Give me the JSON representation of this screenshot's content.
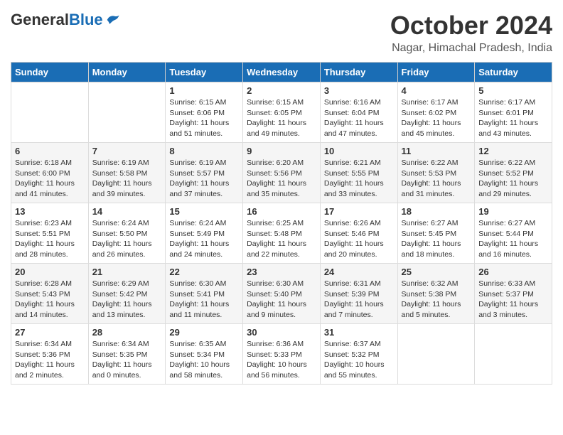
{
  "header": {
    "logo_general": "General",
    "logo_blue": "Blue",
    "month_title": "October 2024",
    "location": "Nagar, Himachal Pradesh, India"
  },
  "weekdays": [
    "Sunday",
    "Monday",
    "Tuesday",
    "Wednesday",
    "Thursday",
    "Friday",
    "Saturday"
  ],
  "weeks": [
    [
      {
        "day": "",
        "sunrise": "",
        "sunset": "",
        "daylight": ""
      },
      {
        "day": "",
        "sunrise": "",
        "sunset": "",
        "daylight": ""
      },
      {
        "day": "1",
        "sunrise": "Sunrise: 6:15 AM",
        "sunset": "Sunset: 6:06 PM",
        "daylight": "Daylight: 11 hours and 51 minutes."
      },
      {
        "day": "2",
        "sunrise": "Sunrise: 6:15 AM",
        "sunset": "Sunset: 6:05 PM",
        "daylight": "Daylight: 11 hours and 49 minutes."
      },
      {
        "day": "3",
        "sunrise": "Sunrise: 6:16 AM",
        "sunset": "Sunset: 6:04 PM",
        "daylight": "Daylight: 11 hours and 47 minutes."
      },
      {
        "day": "4",
        "sunrise": "Sunrise: 6:17 AM",
        "sunset": "Sunset: 6:02 PM",
        "daylight": "Daylight: 11 hours and 45 minutes."
      },
      {
        "day": "5",
        "sunrise": "Sunrise: 6:17 AM",
        "sunset": "Sunset: 6:01 PM",
        "daylight": "Daylight: 11 hours and 43 minutes."
      }
    ],
    [
      {
        "day": "6",
        "sunrise": "Sunrise: 6:18 AM",
        "sunset": "Sunset: 6:00 PM",
        "daylight": "Daylight: 11 hours and 41 minutes."
      },
      {
        "day": "7",
        "sunrise": "Sunrise: 6:19 AM",
        "sunset": "Sunset: 5:58 PM",
        "daylight": "Daylight: 11 hours and 39 minutes."
      },
      {
        "day": "8",
        "sunrise": "Sunrise: 6:19 AM",
        "sunset": "Sunset: 5:57 PM",
        "daylight": "Daylight: 11 hours and 37 minutes."
      },
      {
        "day": "9",
        "sunrise": "Sunrise: 6:20 AM",
        "sunset": "Sunset: 5:56 PM",
        "daylight": "Daylight: 11 hours and 35 minutes."
      },
      {
        "day": "10",
        "sunrise": "Sunrise: 6:21 AM",
        "sunset": "Sunset: 5:55 PM",
        "daylight": "Daylight: 11 hours and 33 minutes."
      },
      {
        "day": "11",
        "sunrise": "Sunrise: 6:22 AM",
        "sunset": "Sunset: 5:53 PM",
        "daylight": "Daylight: 11 hours and 31 minutes."
      },
      {
        "day": "12",
        "sunrise": "Sunrise: 6:22 AM",
        "sunset": "Sunset: 5:52 PM",
        "daylight": "Daylight: 11 hours and 29 minutes."
      }
    ],
    [
      {
        "day": "13",
        "sunrise": "Sunrise: 6:23 AM",
        "sunset": "Sunset: 5:51 PM",
        "daylight": "Daylight: 11 hours and 28 minutes."
      },
      {
        "day": "14",
        "sunrise": "Sunrise: 6:24 AM",
        "sunset": "Sunset: 5:50 PM",
        "daylight": "Daylight: 11 hours and 26 minutes."
      },
      {
        "day": "15",
        "sunrise": "Sunrise: 6:24 AM",
        "sunset": "Sunset: 5:49 PM",
        "daylight": "Daylight: 11 hours and 24 minutes."
      },
      {
        "day": "16",
        "sunrise": "Sunrise: 6:25 AM",
        "sunset": "Sunset: 5:48 PM",
        "daylight": "Daylight: 11 hours and 22 minutes."
      },
      {
        "day": "17",
        "sunrise": "Sunrise: 6:26 AM",
        "sunset": "Sunset: 5:46 PM",
        "daylight": "Daylight: 11 hours and 20 minutes."
      },
      {
        "day": "18",
        "sunrise": "Sunrise: 6:27 AM",
        "sunset": "Sunset: 5:45 PM",
        "daylight": "Daylight: 11 hours and 18 minutes."
      },
      {
        "day": "19",
        "sunrise": "Sunrise: 6:27 AM",
        "sunset": "Sunset: 5:44 PM",
        "daylight": "Daylight: 11 hours and 16 minutes."
      }
    ],
    [
      {
        "day": "20",
        "sunrise": "Sunrise: 6:28 AM",
        "sunset": "Sunset: 5:43 PM",
        "daylight": "Daylight: 11 hours and 14 minutes."
      },
      {
        "day": "21",
        "sunrise": "Sunrise: 6:29 AM",
        "sunset": "Sunset: 5:42 PM",
        "daylight": "Daylight: 11 hours and 13 minutes."
      },
      {
        "day": "22",
        "sunrise": "Sunrise: 6:30 AM",
        "sunset": "Sunset: 5:41 PM",
        "daylight": "Daylight: 11 hours and 11 minutes."
      },
      {
        "day": "23",
        "sunrise": "Sunrise: 6:30 AM",
        "sunset": "Sunset: 5:40 PM",
        "daylight": "Daylight: 11 hours and 9 minutes."
      },
      {
        "day": "24",
        "sunrise": "Sunrise: 6:31 AM",
        "sunset": "Sunset: 5:39 PM",
        "daylight": "Daylight: 11 hours and 7 minutes."
      },
      {
        "day": "25",
        "sunrise": "Sunrise: 6:32 AM",
        "sunset": "Sunset: 5:38 PM",
        "daylight": "Daylight: 11 hours and 5 minutes."
      },
      {
        "day": "26",
        "sunrise": "Sunrise: 6:33 AM",
        "sunset": "Sunset: 5:37 PM",
        "daylight": "Daylight: 11 hours and 3 minutes."
      }
    ],
    [
      {
        "day": "27",
        "sunrise": "Sunrise: 6:34 AM",
        "sunset": "Sunset: 5:36 PM",
        "daylight": "Daylight: 11 hours and 2 minutes."
      },
      {
        "day": "28",
        "sunrise": "Sunrise: 6:34 AM",
        "sunset": "Sunset: 5:35 PM",
        "daylight": "Daylight: 11 hours and 0 minutes."
      },
      {
        "day": "29",
        "sunrise": "Sunrise: 6:35 AM",
        "sunset": "Sunset: 5:34 PM",
        "daylight": "Daylight: 10 hours and 58 minutes."
      },
      {
        "day": "30",
        "sunrise": "Sunrise: 6:36 AM",
        "sunset": "Sunset: 5:33 PM",
        "daylight": "Daylight: 10 hours and 56 minutes."
      },
      {
        "day": "31",
        "sunrise": "Sunrise: 6:37 AM",
        "sunset": "Sunset: 5:32 PM",
        "daylight": "Daylight: 10 hours and 55 minutes."
      },
      {
        "day": "",
        "sunrise": "",
        "sunset": "",
        "daylight": ""
      },
      {
        "day": "",
        "sunrise": "",
        "sunset": "",
        "daylight": ""
      }
    ]
  ]
}
